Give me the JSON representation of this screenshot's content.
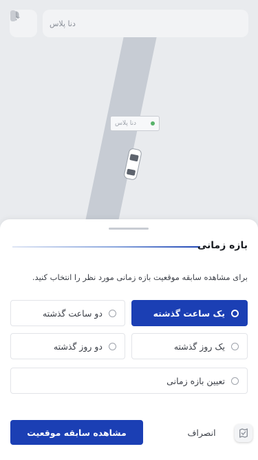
{
  "map": {
    "search_label": "دنا پلاس",
    "marker_label": "دنا پلاس"
  },
  "sheet": {
    "title": "بازه زمانی",
    "description": "برای مشاهده سابقه موقعیت بازه زمانی مورد نظر را انتخاب کنید.",
    "options": [
      {
        "label": "یک ساعت گذشته",
        "selected": true
      },
      {
        "label": "دو ساعت گذشته",
        "selected": false
      },
      {
        "label": "یک روز گذشته",
        "selected": false
      },
      {
        "label": "دو روز گذشته",
        "selected": false
      },
      {
        "label": "تعیین بازه زمانی",
        "selected": false
      }
    ],
    "primary_button": "مشاهده سابقه موقعیت",
    "cancel_button": "انصراف"
  },
  "colors": {
    "accent": "#1b3fb4",
    "map_bg": "#e9ebee",
    "road": "#b9c0cb"
  },
  "icons": {
    "bell": "bell-icon",
    "search": "search-icon",
    "vehicle": "car-icon",
    "floating": "map-app-icon"
  }
}
